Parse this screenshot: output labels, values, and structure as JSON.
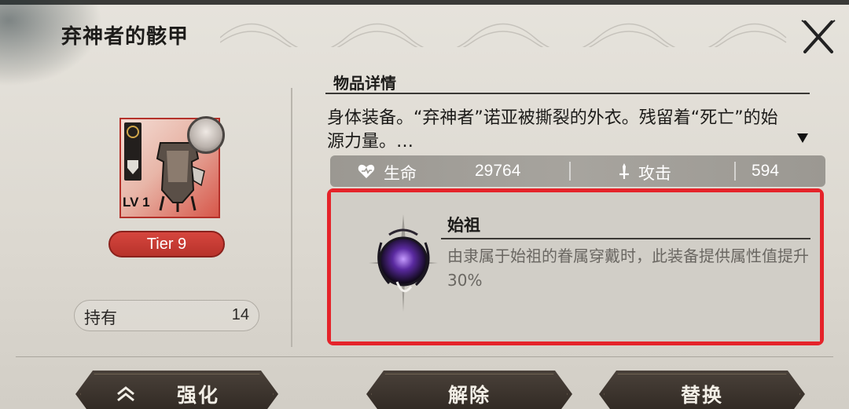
{
  "window": {
    "title": "弃神者的骸甲"
  },
  "item": {
    "level": "LV 1",
    "tier": "Tier 9",
    "owned_label": "持有",
    "owned_count": "14"
  },
  "details": {
    "section_title": "物品详情",
    "description": "身体装备。“弃神者”诺亚被撕裂的外衣。残留着“死亡”的始源力量。…",
    "stats": [
      {
        "icon": "heart-icon",
        "label": "生命",
        "value": "29764"
      },
      {
        "icon": "sword-icon",
        "label": "攻击",
        "value": "594"
      }
    ]
  },
  "skill": {
    "icon": "purple-orb-icon",
    "name": "始祖",
    "description": "由隶属于始祖的眷属穿戴时，此装备提供属性值提升30%"
  },
  "buttons": {
    "enhance": "强化",
    "remove": "解除",
    "replace": "替换"
  },
  "colors": {
    "highlight_border": "#e5232a",
    "tier_badge": "#c73a32",
    "button_bg": "#3a322b"
  }
}
